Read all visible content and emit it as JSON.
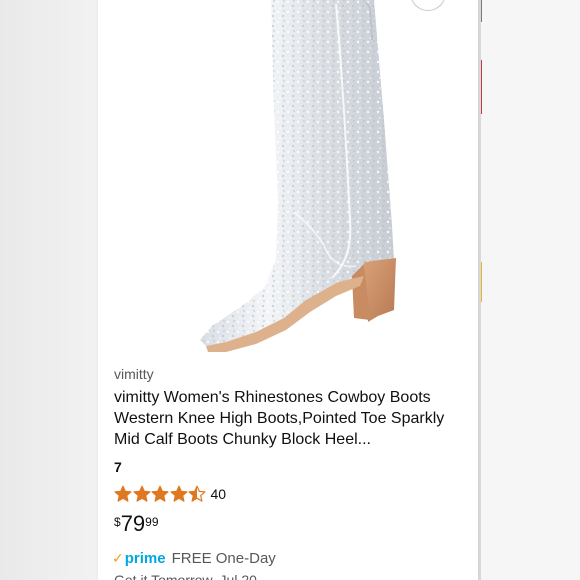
{
  "product": {
    "brand": "vimitty",
    "title": "vimitty Women's Rhinestones Cowboy Boots Western Knee High Boots,Pointed Toe Sparkly Mid Calf Boots Chunky Block Heel...",
    "option_count": "7",
    "rating": {
      "stars": 4.5,
      "review_count": "40",
      "star_color": "#de7921"
    },
    "price": {
      "symbol": "$",
      "whole": "79",
      "fraction": "99"
    },
    "shipping": {
      "prime_check": "✓",
      "prime_label": "prime",
      "prime_color": "#00a8e1",
      "delivery_label": "FREE One-Day",
      "delivery_date_partial": "Get it Tomorrow, Jul 20"
    },
    "image": {
      "icon": "rhinestone-cowboy-boot-image"
    }
  },
  "ui": {
    "zoom_icon": "zoom-icon"
  }
}
